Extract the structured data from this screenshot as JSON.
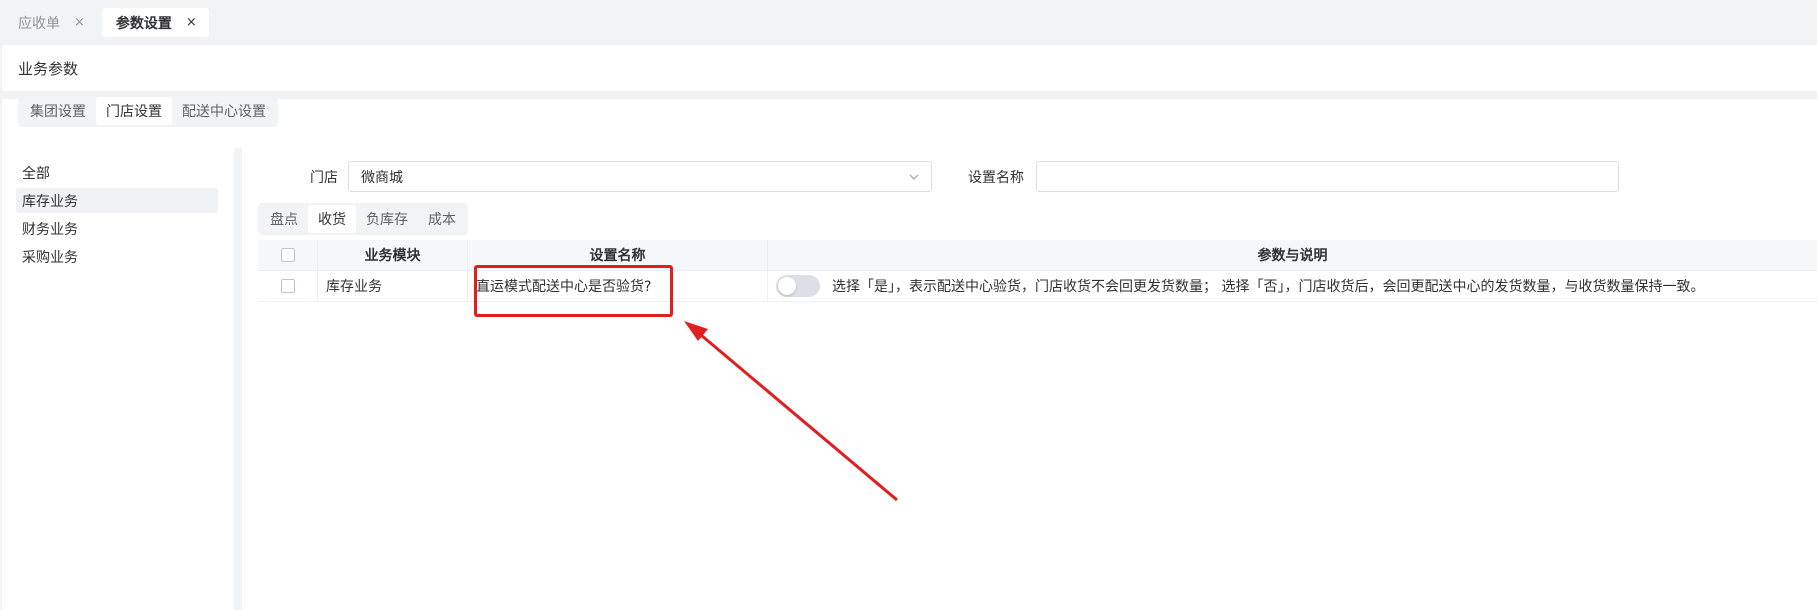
{
  "tabs": [
    {
      "label": "应收单",
      "active": false
    },
    {
      "label": "参数设置",
      "active": true
    }
  ],
  "tab_close_glyph": "×",
  "header": {
    "title": "业务参数"
  },
  "settings_tabs": [
    "集团设置",
    "门店设置",
    "配送中心设置"
  ],
  "left_nav": [
    "全部",
    "库存业务",
    "财务业务",
    "采购业务"
  ],
  "filters": {
    "store_label": "门店",
    "store_value": "微商城",
    "name_label": "设置名称",
    "name_value": ""
  },
  "sub_tabs": [
    "盘点",
    "收货",
    "负库存",
    "成本"
  ],
  "table": {
    "headers": {
      "module": "业务模块",
      "name": "设置名称",
      "desc": "参数与说明"
    },
    "rows": [
      {
        "module": "库存业务",
        "name": "直运模式配送中心是否验货?",
        "toggle_on": false,
        "desc": "选择「是」，表示配送中心验货，门店收货不会回更发货数量； 选择「否」，门店收货后，会回更配送中心的发货数量，与收货数量保持一致。"
      }
    ]
  },
  "colors": {
    "accent_annotation": "#e02020",
    "toggle_off": "#dcdfe6"
  },
  "icons": {
    "select_arrow": "chevron-down-icon",
    "tab_close": "close-icon"
  }
}
